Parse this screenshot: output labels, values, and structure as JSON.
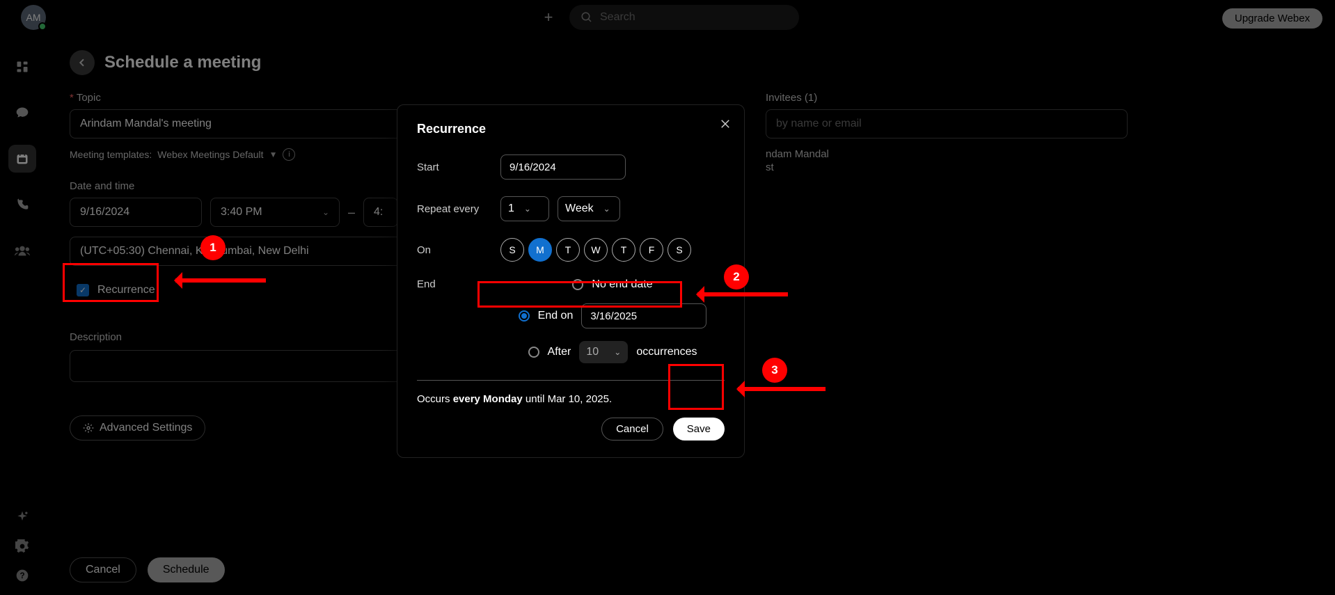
{
  "topbar": {
    "avatar_initials": "AM",
    "search_placeholder": "Search",
    "upgrade_label": "Upgrade Webex"
  },
  "page": {
    "title": "Schedule a meeting",
    "topic_label": "Topic",
    "topic_value": "Arindam Mandal's meeting",
    "templates_prefix": "Meeting templates:",
    "templates_value": "Webex Meetings Default",
    "date_time_label": "Date and time",
    "date_value": "9/16/2024",
    "start_time": "3:40 PM",
    "end_time": "4:",
    "timezone": "(UTC+05:30) Chennai, Ko        Mumbai, New Delhi",
    "recurrence_label": "Recurrence",
    "description_label": "Description",
    "advanced_label": "Advanced Settings",
    "cancel_label": "Cancel",
    "schedule_label": "Schedule"
  },
  "invitees": {
    "label": "Invitees (1)",
    "placeholder": "by name or email",
    "name": "ndam Mandal",
    "role": "st"
  },
  "modal": {
    "title": "Recurrence",
    "start_label": "Start",
    "start_value": "9/16/2024",
    "repeat_label": "Repeat every",
    "repeat_count": "1",
    "repeat_unit": "Week",
    "on_label": "On",
    "days": [
      "S",
      "M",
      "T",
      "W",
      "T",
      "F",
      "S"
    ],
    "active_day_index": 1,
    "end_label": "End",
    "no_end_label": "No end date",
    "end_on_label": "End on",
    "end_on_value": "3/16/2025",
    "after_label": "After",
    "after_count": "10",
    "occurrences_label": "occurrences",
    "summary_prefix": "Occurs ",
    "summary_bold": "every Monday",
    "summary_suffix": " until Mar 10, 2025.",
    "cancel_label": "Cancel",
    "save_label": "Save"
  },
  "annotations": {
    "a1": "1",
    "a2": "2",
    "a3": "3"
  }
}
